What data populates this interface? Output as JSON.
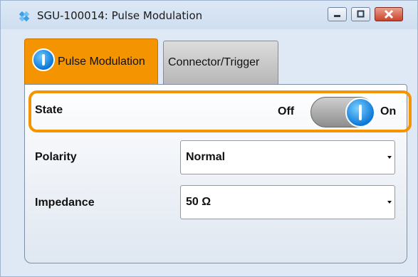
{
  "window": {
    "title": "SGU-100014: Pulse Modulation",
    "controls": [
      "minimize-icon",
      "maximize-icon",
      "close-icon"
    ]
  },
  "tabs": [
    {
      "label": "Pulse Modulation",
      "active": true
    },
    {
      "label": "Connector/Trigger",
      "active": false
    }
  ],
  "state": {
    "label": "State",
    "off_label": "Off",
    "on_label": "On",
    "value": "On"
  },
  "polarity": {
    "label": "Polarity",
    "value": "Normal"
  },
  "impedance": {
    "label": "Impedance",
    "value": "50 Ω"
  },
  "colors": {
    "accent": "#f39400",
    "toggle_blue": "#0b78d8"
  }
}
